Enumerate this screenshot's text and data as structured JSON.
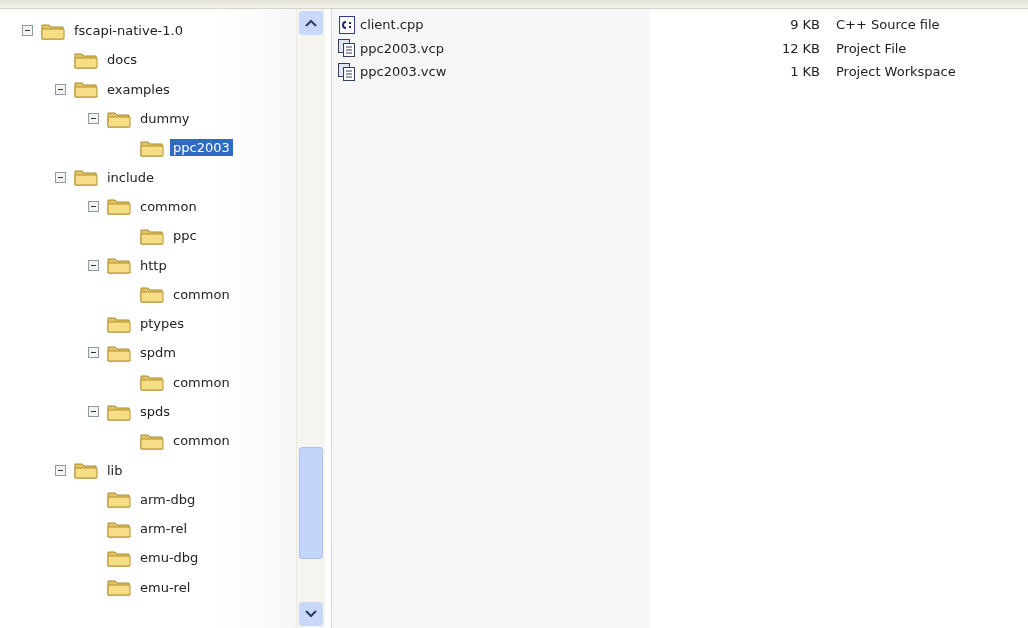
{
  "tree": [
    {
      "label": "fscapi-native-1.0",
      "expanded": true,
      "selected": false,
      "children": [
        {
          "label": "docs",
          "selected": false
        },
        {
          "label": "examples",
          "expanded": true,
          "selected": false,
          "children": [
            {
              "label": "dummy",
              "expanded": true,
              "selected": false,
              "children": [
                {
                  "label": "ppc2003",
                  "selected": true
                }
              ]
            }
          ]
        },
        {
          "label": "include",
          "expanded": true,
          "selected": false,
          "children": [
            {
              "label": "common",
              "expanded": true,
              "selected": false,
              "children": [
                {
                  "label": "ppc",
                  "selected": false
                }
              ]
            },
            {
              "label": "http",
              "expanded": true,
              "selected": false,
              "children": [
                {
                  "label": "common",
                  "selected": false
                }
              ]
            },
            {
              "label": "ptypes",
              "selected": false
            },
            {
              "label": "spdm",
              "expanded": true,
              "selected": false,
              "children": [
                {
                  "label": "common",
                  "selected": false
                }
              ]
            },
            {
              "label": "spds",
              "expanded": true,
              "selected": false,
              "children": [
                {
                  "label": "common",
                  "selected": false
                }
              ]
            }
          ]
        },
        {
          "label": "lib",
          "expanded": true,
          "selected": false,
          "children": [
            {
              "label": "arm-dbg",
              "selected": false
            },
            {
              "label": "arm-rel",
              "selected": false
            },
            {
              "label": "emu-dbg",
              "selected": false
            },
            {
              "label": "emu-rel",
              "selected": false
            }
          ]
        }
      ]
    }
  ],
  "files": [
    {
      "name": "client.cpp",
      "kind": "source",
      "size": "9 KB",
      "type": "C++ Source file"
    },
    {
      "name": "ppc2003.vcp",
      "kind": "project",
      "size": "12 KB",
      "type": "Project File"
    },
    {
      "name": "ppc2003.vcw",
      "kind": "project",
      "size": "1 KB",
      "type": "Project Workspace"
    }
  ]
}
